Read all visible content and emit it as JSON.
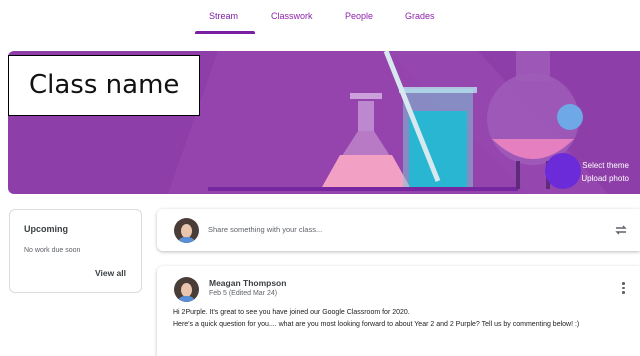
{
  "tabs": [
    {
      "label": "Stream",
      "active": true
    },
    {
      "label": "Classwork",
      "active": false
    },
    {
      "label": "People",
      "active": false
    },
    {
      "label": "Grades",
      "active": false
    }
  ],
  "banner": {
    "class_name": "Class name",
    "select_theme": "Select theme",
    "upload_photo": "Upload photo",
    "background_color": "#8e3ea8"
  },
  "upcoming": {
    "title": "Upcoming",
    "empty_text": "No work due soon",
    "view_all": "View all"
  },
  "share": {
    "placeholder": "Share something with your class...",
    "icon": "repost-icon"
  },
  "post": {
    "author": "Meagan Thompson",
    "date": "Feb 5 (Edited Mar 24)",
    "line1": "Hi 2Purple. It's great to see you have joined our Google Classroom for 2020.",
    "line2": "Here's a quick question for you.... what are you most looking forward to about Year 2 and 2 Purple? Tell us by commenting below! :)",
    "menu_icon": "more-vert-icon"
  },
  "colors": {
    "accent": "#7b1fa2",
    "banner": "#8e3ea8"
  }
}
